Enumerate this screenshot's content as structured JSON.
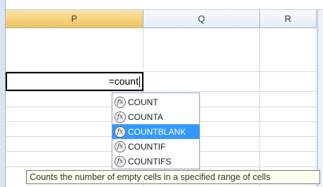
{
  "columns": [
    {
      "label": "P",
      "selected": true
    },
    {
      "label": "Q",
      "selected": false
    },
    {
      "label": "R",
      "selected": false
    }
  ],
  "active_cell": {
    "formula": "=count"
  },
  "autocomplete": {
    "items": [
      {
        "label": "COUNT",
        "highlighted": false,
        "icon": "function-icon"
      },
      {
        "label": "COUNTA",
        "highlighted": false,
        "icon": "function-icon"
      },
      {
        "label": "COUNTBLANK",
        "highlighted": true,
        "icon": "function-icon"
      },
      {
        "label": "COUNTIF",
        "highlighted": false,
        "icon": "function-icon"
      },
      {
        "label": "COUNTIFS",
        "highlighted": false,
        "icon": "function-icon"
      }
    ]
  },
  "tooltip": {
    "text": "Counts the number of empty cells in a specified range of cells"
  },
  "colors": {
    "selected_header": "#f2c35a",
    "highlight": "#3399ff",
    "header_text": "#27415f"
  }
}
